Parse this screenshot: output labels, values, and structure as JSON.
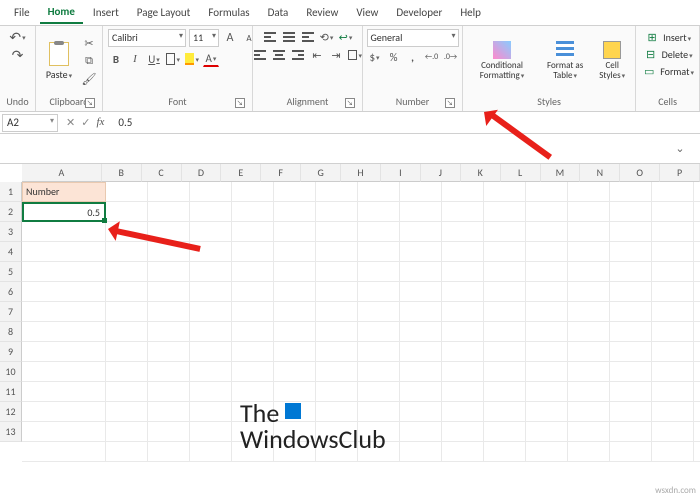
{
  "tabs": [
    "File",
    "Home",
    "Insert",
    "Page Layout",
    "Formulas",
    "Data",
    "Review",
    "View",
    "Developer",
    "Help"
  ],
  "active_tab": "Home",
  "ribbon": {
    "undo_label": "Undo",
    "clipboard": {
      "paste": "Paste",
      "label": "Clipboard"
    },
    "font": {
      "name": "Calibri",
      "size": "11",
      "aplus": "A",
      "aminus": "A",
      "bold": "B",
      "italic": "I",
      "underline": "U",
      "fontcolor": "A",
      "label": "Font"
    },
    "alignment": {
      "label": "Alignment"
    },
    "number": {
      "format": "General",
      "currency": "$",
      "percent": "%",
      "comma": ",",
      "dec_inc": ".00",
      "dec_dec": ".00",
      "label": "Number"
    },
    "styles": {
      "cond": "Conditional Formatting",
      "table": "Format as Table",
      "cell": "Cell Styles",
      "label": "Styles"
    },
    "cells": {
      "insert": "Insert",
      "delete": "Delete",
      "format": "Format",
      "label": "Cells"
    }
  },
  "namebox": "A2",
  "fx": {
    "cancel": "✕",
    "enter": "✓",
    "fx": "fx"
  },
  "formula": "0.5",
  "columns": [
    "A",
    "B",
    "C",
    "D",
    "E",
    "F",
    "G",
    "H",
    "I",
    "J",
    "K",
    "L",
    "M",
    "N",
    "O",
    "P"
  ],
  "rows": [
    "1",
    "2",
    "3",
    "4",
    "5",
    "6",
    "7",
    "8",
    "9",
    "10",
    "11",
    "12",
    "13"
  ],
  "cell_a1": "Number",
  "cell_a2": "0.5",
  "watermark": {
    "line1": "The",
    "line2": "WindowsClub"
  },
  "attribution": "wsxdn.com"
}
